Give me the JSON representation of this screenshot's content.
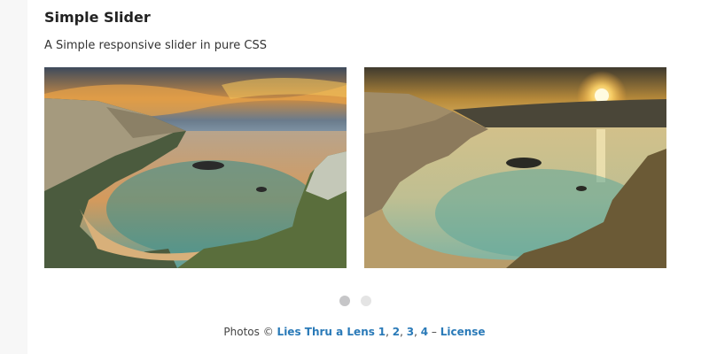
{
  "header": {
    "title": "Simple Slider",
    "subtitle": "A Simple responsive slider in pure CSS"
  },
  "slider": {
    "dots": [
      {
        "label": "slide 1",
        "active": true
      },
      {
        "label": "slide 2",
        "active": false
      }
    ]
  },
  "credits": {
    "prefix": "Photos © ",
    "author_link": "Lies Thru a Lens",
    "photo_links": [
      "1",
      "2",
      "3",
      "4"
    ],
    "separator": ", ",
    "dash": " – ",
    "license_link": "License"
  },
  "colors": {
    "link": "#2a7ab8",
    "dot_active": "#c6c6c8",
    "dot_inactive": "#e4e4e4"
  }
}
